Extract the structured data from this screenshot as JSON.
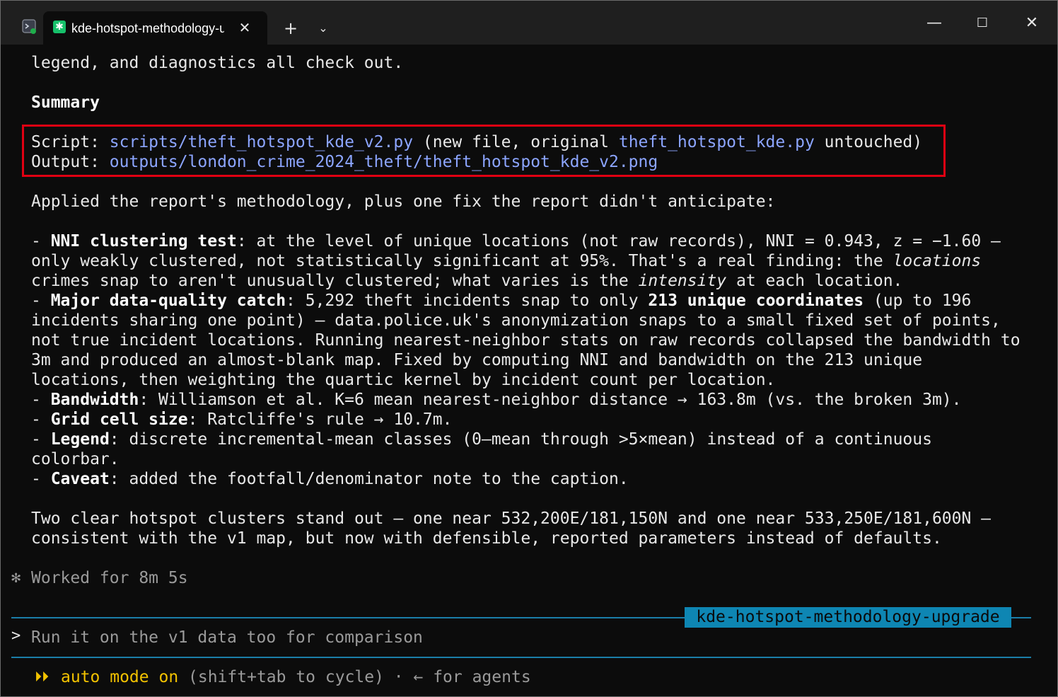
{
  "titlebar": {
    "tab_title": "kde-hotspot-methodology-upgrade",
    "tab_close": "✕",
    "new_tab": "+",
    "dropdown": "⌄",
    "minimize": "—",
    "maximize": "☐",
    "close": "✕"
  },
  "terminal": {
    "l1": "legend, and diagnostics all check out.",
    "summary": "Summary",
    "script_label": "Script: ",
    "script_path": "scripts/theft_hotspot_kde_v2.py",
    "script_mid": " (new file, original ",
    "script_orig": "theft_hotspot_kde.py",
    "script_end": " untouched)",
    "output_label": "Output: ",
    "output_path": "outputs/london_crime_2024_theft/theft_hotspot_kde_v2.png",
    "applied": "Applied the report's methodology, plus one fix the report didn't anticipate:",
    "nni_bullet": "- ",
    "nni_title": "NNI clustering test",
    "nni_text": ": at the level of unique locations (not raw records), NNI = 0.943, z = −1.60 –",
    "nni_line2": "only weakly clustered, not statistically significant at 95%. That's a real finding: the ",
    "nni_locations": "locations",
    "nni_line3a": "crimes snap to aren't unusually clustered; what varies is the ",
    "nni_intensity": "intensity",
    "nni_line3b": " at each location.",
    "major_bullet": "- ",
    "major_title": "Major data-quality catch",
    "major_text": ": 5,292 theft incidents snap to only ",
    "major_bold": "213 unique coordinates",
    "major_end": " (up to 196",
    "major_line2": "incidents sharing one point) – data.police.uk's anonymization snaps to a small fixed set of points,",
    "major_line3": "not true incident locations. Running nearest-neighbor stats on raw records collapsed the bandwidth to",
    "major_line4": "3m and produced an almost-blank map. Fixed by computing NNI and bandwidth on the 213 unique",
    "major_line5": "locations, then weighting the quartic kernel by incident count per location.",
    "bw_bullet": "- ",
    "bw_title": "Bandwidth",
    "bw_text": ": Williamson et al. K=6 mean nearest-neighbor distance → 163.8m (vs. the broken 3m).",
    "grid_bullet": "- ",
    "grid_title": "Grid cell size",
    "grid_text": ": Ratcliffe's rule → 10.7m.",
    "legend_bullet": "- ",
    "legend_title": "Legend",
    "legend_text": ": discrete incremental-mean classes (0–mean through >5×mean) instead of a continuous",
    "legend_line2": "colorbar.",
    "caveat_bullet": "- ",
    "caveat_title": "Caveat",
    "caveat_text": ": added the footfall/denominator note to the caption.",
    "clusters_line1": "Two clear hotspot clusters stand out – one near 532,200E/181,150N and one near 533,250E/181,600N –",
    "clusters_line2": "consistent with the v1 map, but now with defensible, reported parameters instead of defaults.",
    "worked_icon": "✻",
    "worked": "Worked for 8m 5s",
    "branch": "kde-hotspot-methodology-upgrade",
    "prompt_char": ">",
    "prompt_placeholder": "Run it on the v1 data too for comparison",
    "mode_arrows": "⏵⏵",
    "mode_label": "auto mode on",
    "mode_rest": " (shift+tab to cycle) · ← for agents"
  }
}
